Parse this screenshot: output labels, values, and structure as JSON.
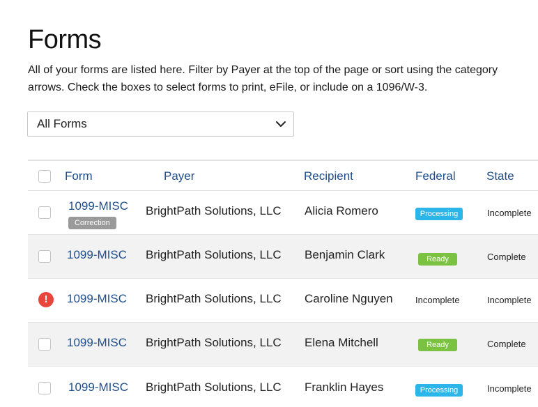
{
  "page": {
    "title": "Forms",
    "intro": "All of your forms are listed here. Filter by Payer at the top of the page or sort using the category arrows. Check the boxes to select forms to print, eFile, or include on a 1096/W-3."
  },
  "filter": {
    "selected": "All Forms",
    "icon": "chevron-down-icon"
  },
  "table": {
    "headers": {
      "form": "Form",
      "payer": "Payer",
      "recipient": "Recipient",
      "federal": "Federal",
      "state": "State"
    },
    "rows": [
      {
        "form": "1099-MISC",
        "badge": "Correction",
        "payer": "BrightPath Solutions, LLC",
        "recipient": "Alicia Romero",
        "federal": "Processing",
        "state": "Incomplete"
      },
      {
        "form": "1099-MISC",
        "payer": "BrightPath Solutions, LLC",
        "recipient": "Benjamin Clark",
        "federal": "Ready",
        "state": "Complete"
      },
      {
        "form": "1099-MISC",
        "payer": "BrightPath Solutions, LLC",
        "recipient": "Caroline Nguyen",
        "federal": "Incomplete",
        "state": "Incomplete",
        "error_icon": "!"
      },
      {
        "form": "1099-MISC",
        "payer": "BrightPath Solutions, LLC",
        "recipient": "Elena Mitchell",
        "federal": "Ready",
        "state": "Complete"
      },
      {
        "form": "1099-MISC",
        "payer": "BrightPath Solutions, LLC",
        "recipient": "Franklin Hayes",
        "federal": "Processing",
        "state": "Incomplete"
      }
    ]
  },
  "colors": {
    "link": "#1f4e8c",
    "processing": "#2bb5e8",
    "ready": "#7cc242",
    "correction": "#9a9a9a",
    "error": "#e8453c",
    "row_alt": "#f2f2f2"
  }
}
